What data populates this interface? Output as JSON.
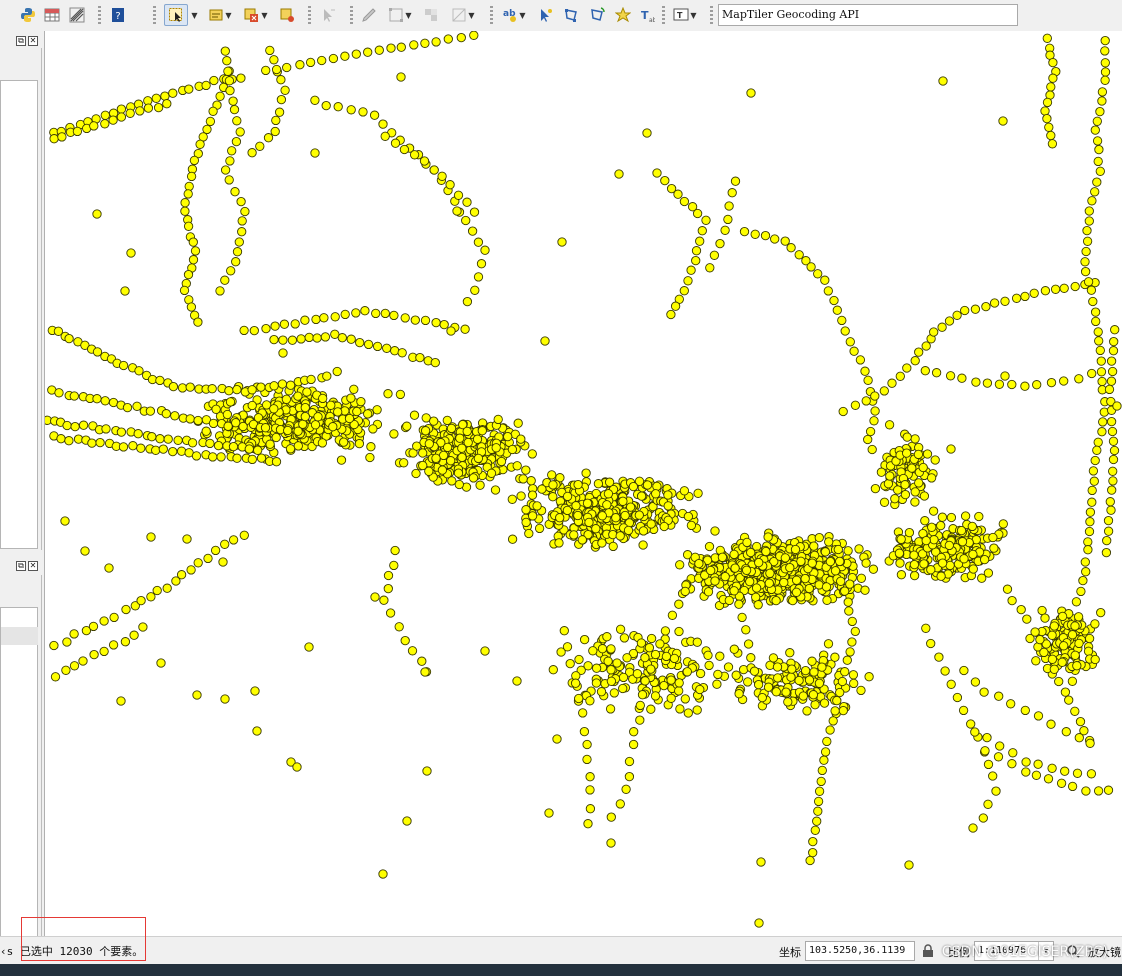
{
  "toolbar": {
    "tools": [
      {
        "name": "python-console-icon",
        "color": "#3a75b0"
      },
      {
        "name": "attribute-table-icon",
        "color": "#7a7a7a"
      },
      {
        "name": "statistics-icon",
        "color": "#555555"
      },
      {
        "name": "help-icon",
        "color": "#1f4f9a"
      },
      {
        "name": "select-features-icon",
        "color": "#e3a41c",
        "active": true
      },
      {
        "name": "select-by-value-icon",
        "color": "#e8b830"
      },
      {
        "name": "deselect-icon",
        "color": "#d84a2c"
      },
      {
        "name": "select-location-icon",
        "color": "#e8b830"
      },
      {
        "name": "identify-icon",
        "color": "#9a9a9a"
      },
      {
        "name": "digitize-icon",
        "color": "#9a9a9a"
      },
      {
        "name": "vertex-tool-icon",
        "color": "#9a9a9a"
      },
      {
        "name": "merge-icon",
        "color": "#9a9a9a"
      },
      {
        "name": "split-icon",
        "color": "#9a9a9a"
      },
      {
        "name": "label-tool-icon",
        "color": "#2f63b0"
      },
      {
        "name": "pin-label-icon",
        "color": "#2f63b0"
      },
      {
        "name": "node-tool-icon",
        "color": "#2f63b0"
      },
      {
        "name": "rotate-icon",
        "color": "#2f63b0"
      },
      {
        "name": "star-icon",
        "color": "#e8c020"
      },
      {
        "name": "text-annotation-icon",
        "color": "#2f63b0"
      },
      {
        "name": "annotation-icon",
        "color": "#555555"
      }
    ],
    "search_placeholder": "MapTiler Geocoding API"
  },
  "status": {
    "message": "‹s 已选中 12030 个要素。",
    "coordinate_label": "坐标",
    "coordinate_value": "103.5250,36.1139",
    "scale_label": "比例",
    "scale_value": "1:110976",
    "magnifier_label": "放大镜"
  },
  "watermark": "CSDN @01EGISER(ZPC)",
  "colors": {
    "point_fill": "#ffff00",
    "point_stroke": "#3a3a00",
    "highlight": "#e53935"
  }
}
